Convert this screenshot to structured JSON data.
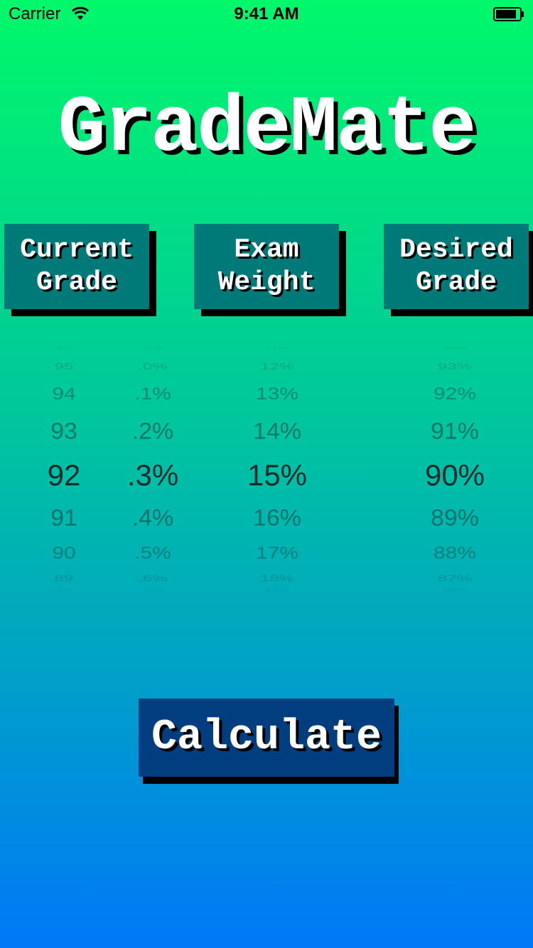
{
  "status_bar": {
    "carrier": "Carrier",
    "time": "9:41 AM"
  },
  "app": {
    "title": "GradeMate"
  },
  "headers": {
    "current": "Current\nGrade",
    "exam": "Exam\nWeight",
    "desired": "Desired\nGrade"
  },
  "pickers": {
    "current_whole": [
      "96",
      "95",
      "94",
      "93",
      "92",
      "91",
      "90",
      "89",
      "88"
    ],
    "current_decimal": [
      ".9%",
      ".0%",
      ".1%",
      ".2%",
      ".3%",
      ".4%",
      ".5%",
      ".6%",
      ".7%"
    ],
    "exam_weight": [
      "11%",
      "12%",
      "13%",
      "14%",
      "15%",
      "16%",
      "17%",
      "18%",
      "19%"
    ],
    "desired_grade": [
      "94%",
      "93%",
      "92%",
      "91%",
      "90%",
      "89%",
      "88%",
      "87%",
      "86%"
    ],
    "selected_index": 4
  },
  "actions": {
    "calculate_label": "Calculate"
  },
  "colors": {
    "gradient_top": "#00f86a",
    "gradient_bottom": "#0078f8",
    "header_button": "#007a78",
    "calculate_button": "#013e7f"
  }
}
